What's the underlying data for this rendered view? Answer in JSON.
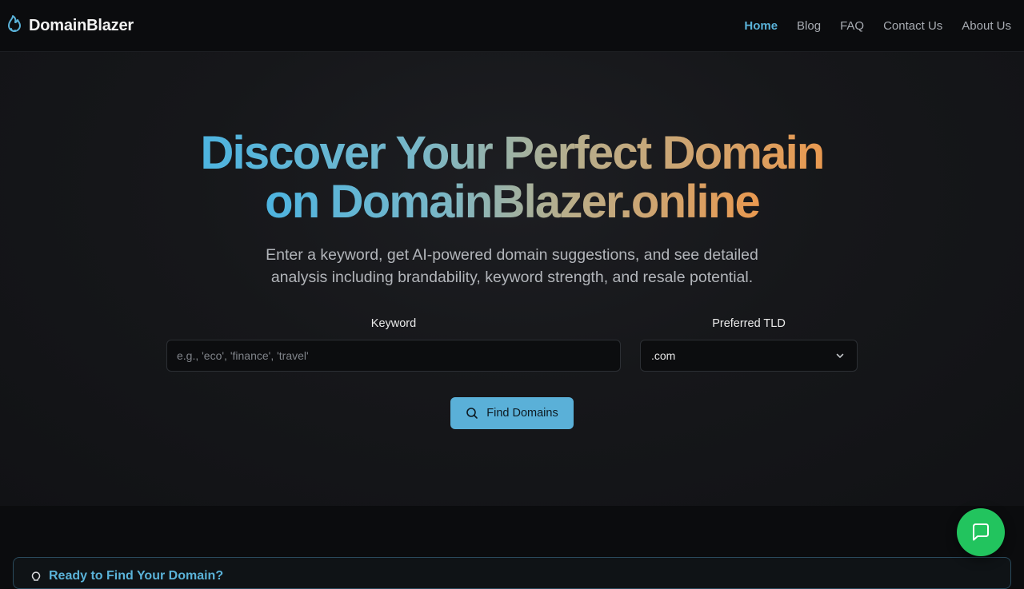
{
  "brand": {
    "name": "DomainBlazer",
    "icon": "flame-icon"
  },
  "nav": {
    "items": [
      {
        "label": "Home",
        "active": true
      },
      {
        "label": "Blog",
        "active": false
      },
      {
        "label": "FAQ",
        "active": false
      },
      {
        "label": "Contact Us",
        "active": false
      },
      {
        "label": "About Us",
        "active": false
      }
    ]
  },
  "hero": {
    "title_line1": "Discover Your Perfect Domain",
    "title_line2": "on DomainBlazer.online",
    "subtitle": "Enter a keyword, get AI-powered domain suggestions, and see detailed analysis including brandability, keyword strength, and resale potential."
  },
  "form": {
    "keyword_label": "Keyword",
    "keyword_placeholder": "e.g., 'eco', 'finance', 'travel'",
    "keyword_value": "",
    "tld_label": "Preferred TLD",
    "tld_value": ".com",
    "submit_label": "Find Domains",
    "submit_icon": "search-icon"
  },
  "ready_section": {
    "title": "Ready to Find Your Domain?",
    "icon": "lightbulb-icon"
  },
  "chat": {
    "icon": "chat-bubble-icon"
  },
  "colors": {
    "accent": "#5ab0d8",
    "background": "#0b0c0e",
    "chat_button": "#22c45e",
    "gradient_start": "#4db4e0",
    "gradient_end": "#e99950"
  }
}
